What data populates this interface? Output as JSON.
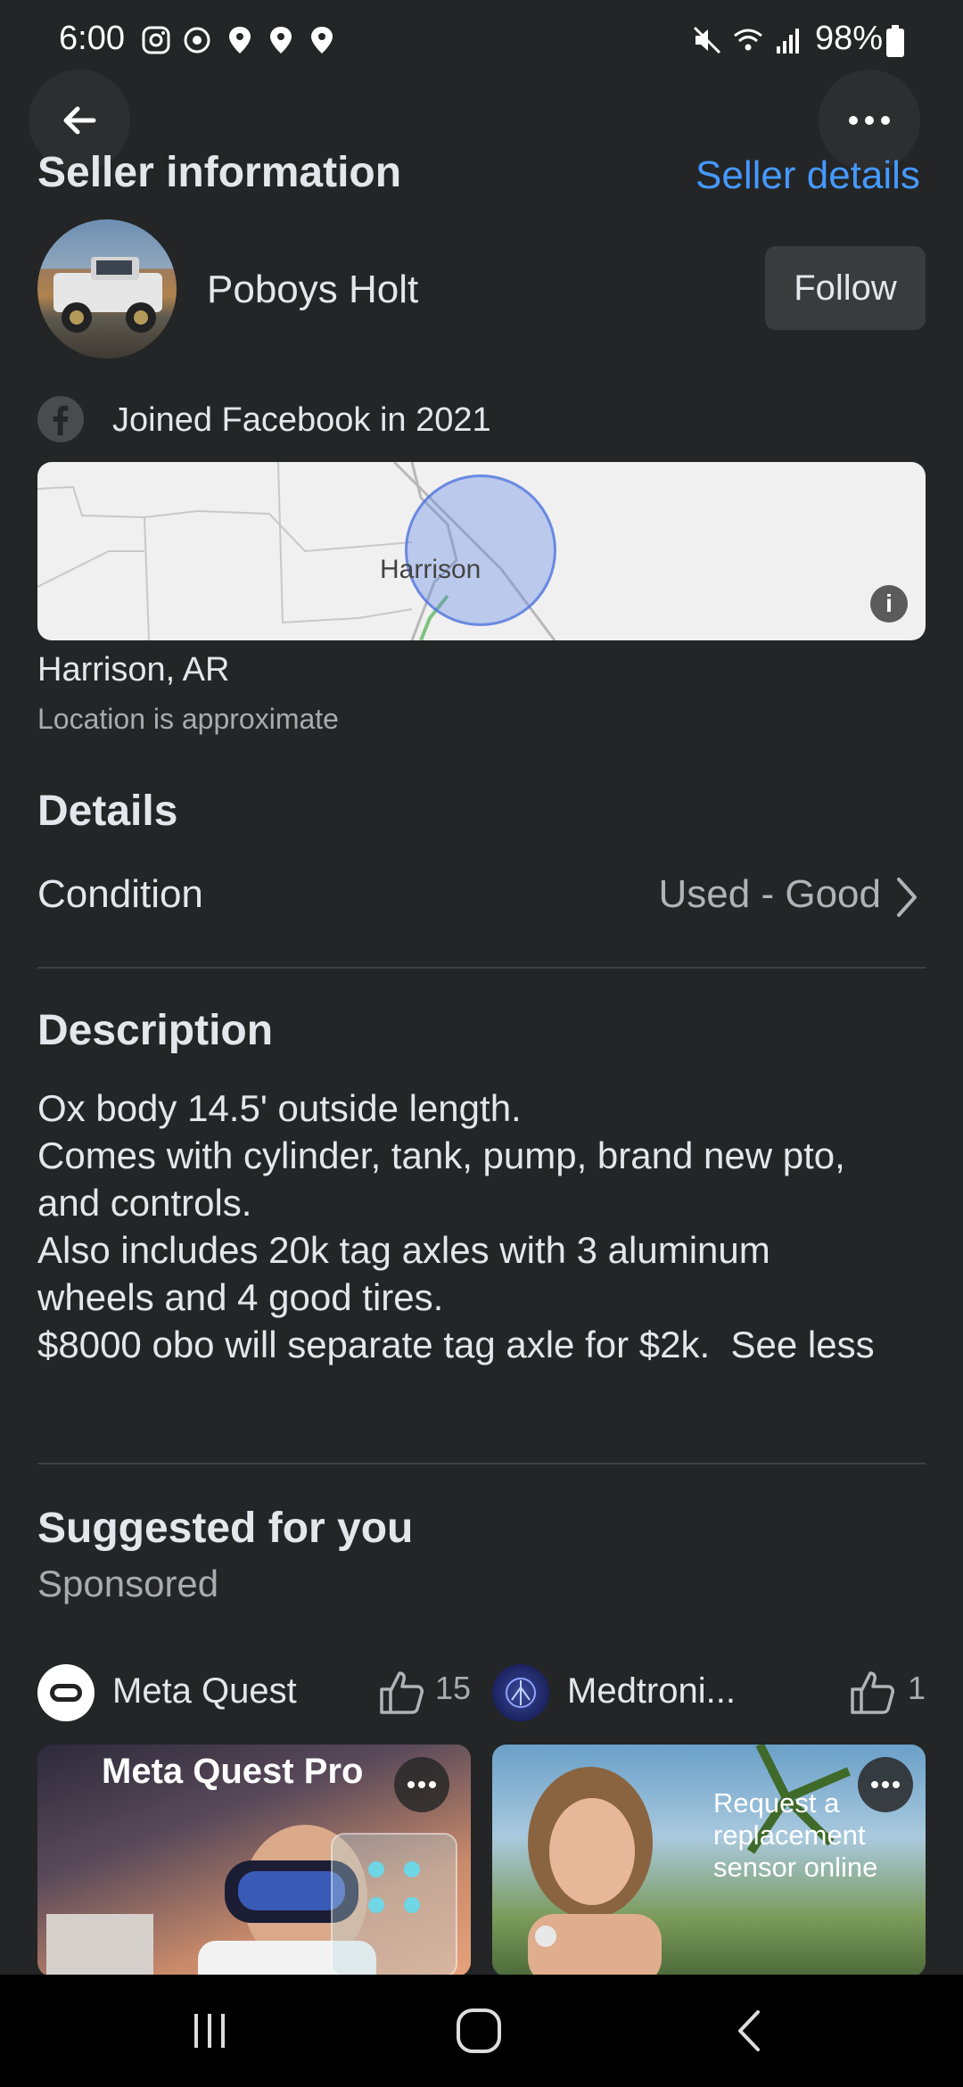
{
  "status_bar": {
    "time": "6:00",
    "battery": "98%"
  },
  "seller": {
    "section_title": "Seller information",
    "details_link": "Seller details",
    "name": "Poboys Holt",
    "follow_label": "Follow",
    "joined": "Joined Facebook in 2021"
  },
  "location": {
    "map_label": "Harrison",
    "city": "Harrison, AR",
    "note": "Location is approximate"
  },
  "details": {
    "title": "Details",
    "condition_label": "Condition",
    "condition_value": "Used - Good"
  },
  "description": {
    "title": "Description",
    "lines": [
      "Ox body 14.5' outside length.",
      "Comes with cylinder,  tank, pump, brand new pto,",
      "and controls.",
      "Also includes 20k tag axles with 3 aluminum",
      "wheels and 4 good tires.",
      "$8000 obo will separate tag axle for $2k."
    ],
    "see_less": "See less"
  },
  "suggested": {
    "title": "Suggested for you",
    "subtitle": "Sponsored",
    "cards": [
      {
        "advertiser": "Meta Quest",
        "likes": "15",
        "banner": "Meta Quest Pro"
      },
      {
        "advertiser": "Medtroni...",
        "likes": "1",
        "overlay_text": [
          "Request a",
          "replacement",
          "sensor online"
        ]
      }
    ]
  },
  "colors": {
    "background": "#242526",
    "accent_link": "#4599ff",
    "button_bg": "#3a3b3c"
  }
}
